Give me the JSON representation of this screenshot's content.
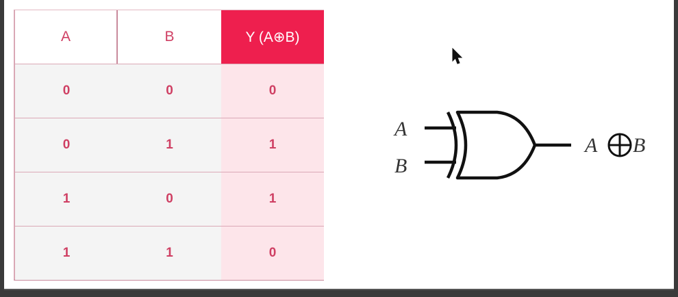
{
  "table": {
    "headers": [
      "A",
      "B",
      "Y (A⊕B)"
    ],
    "rows": [
      [
        "0",
        "0",
        "0"
      ],
      [
        "0",
        "1",
        "1"
      ],
      [
        "1",
        "0",
        "1"
      ],
      [
        "1",
        "1",
        "0"
      ]
    ]
  },
  "gate": {
    "input_a": "A",
    "input_b": "B",
    "output_left": "A",
    "output_right": "B"
  },
  "colors": {
    "accent": "#ee1f4e",
    "text": "#cf3f63",
    "y_column_bg": "#fde5ea"
  }
}
